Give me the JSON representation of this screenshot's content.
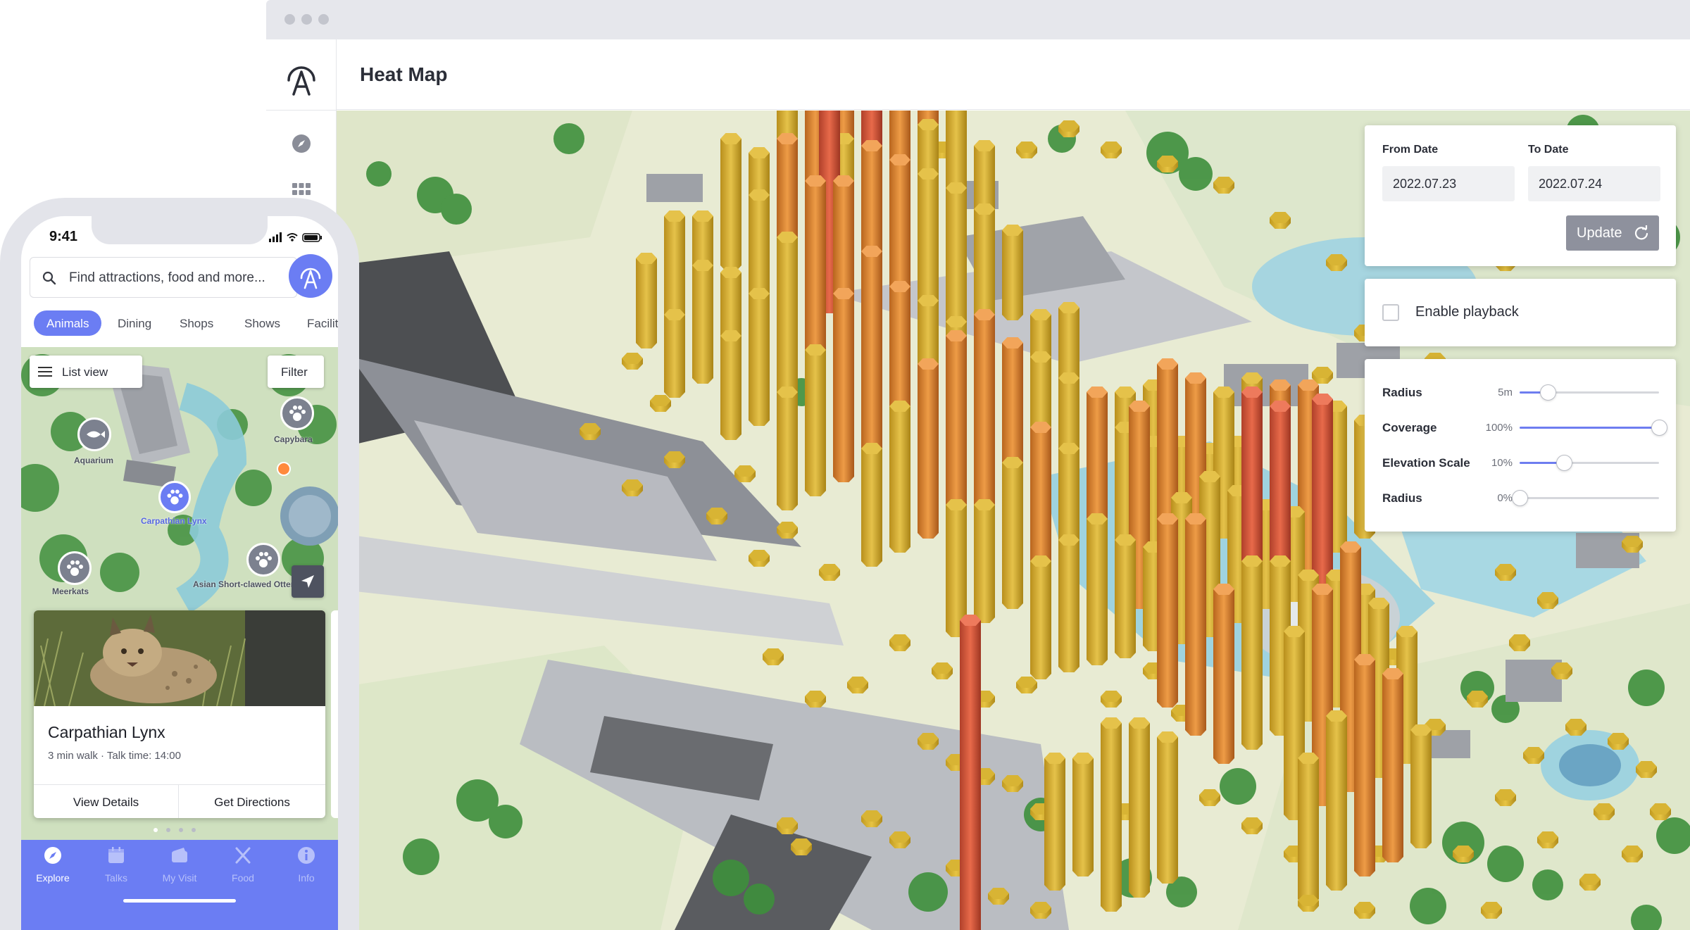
{
  "window": {
    "title": "Heat Map"
  },
  "controls": {
    "date": {
      "from_label": "From Date",
      "from_value": "2022.07.23",
      "to_label": "To Date",
      "to_value": "2022.07.24",
      "update_label": "Update"
    },
    "playback": {
      "label": "Enable playback",
      "checked": false
    },
    "sliders": [
      {
        "name": "Radius",
        "value_text": "5m",
        "level": 0.2
      },
      {
        "name": "Coverage",
        "value_text": "100%",
        "level": 1.0
      },
      {
        "name": "Elevation Scale",
        "value_text": "10%",
        "level": 0.32
      },
      {
        "name": "Radius",
        "value_text": "0%",
        "level": 0.0
      }
    ]
  },
  "mobile": {
    "status_time": "9:41",
    "search_placeholder": "Find attractions, food and more...",
    "categories": [
      "Animals",
      "Dining",
      "Shops",
      "Shows",
      "Faciliti"
    ],
    "active_category": "Animals",
    "list_view_label": "List view",
    "filter_label": "Filter",
    "pins": [
      "Aquarium",
      "Capybara",
      "Carpathian Lynx",
      "Asian Short-clawed Otter",
      "Meerkats"
    ],
    "card": {
      "title": "Carpathian Lynx",
      "subtitle": "3 min walk · Talk time: 14:00",
      "view_details": "View Details",
      "get_directions": "Get Directions"
    },
    "tabs": [
      "Explore",
      "Talks",
      "My Visit",
      "Food",
      "Info"
    ],
    "active_tab": "Explore"
  },
  "colors": {
    "accent": "#6b7df3",
    "update_button": "#8e919d",
    "heat_low": "#d4ad2e",
    "heat_mid": "#e0862e",
    "heat_high": "#d65a3a"
  }
}
